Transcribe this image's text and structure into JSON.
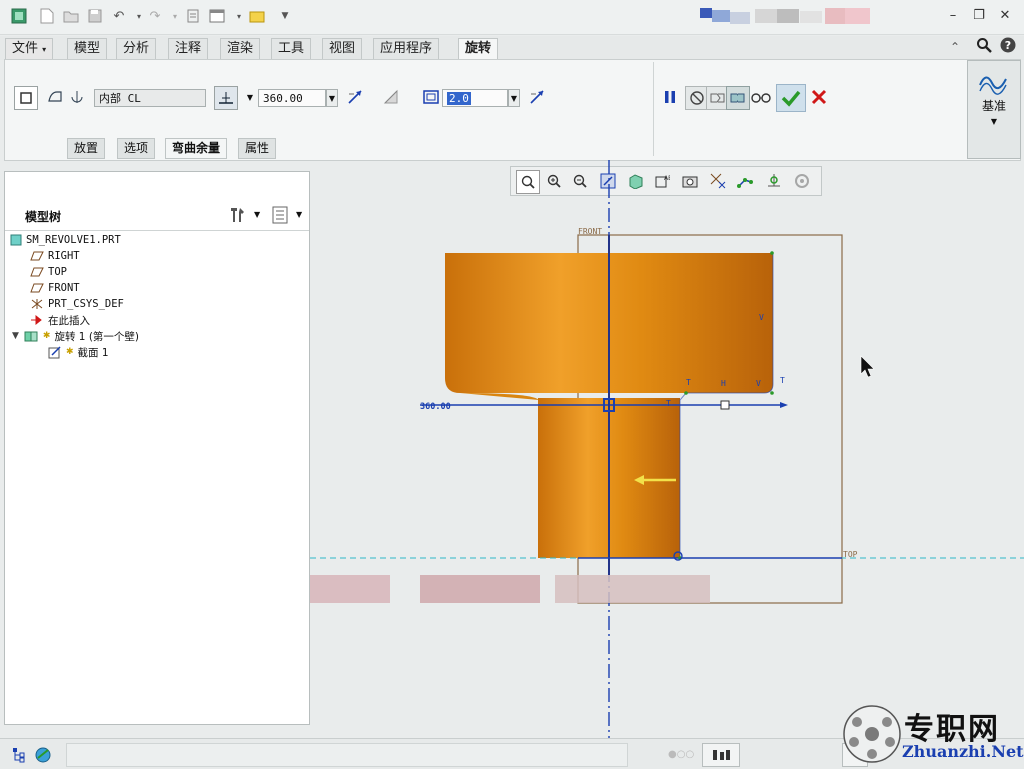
{
  "title_bar": {
    "window_controls": [
      "minimize-icon",
      "restore-icon",
      "close-icon"
    ]
  },
  "tabs": [
    {
      "label": "文件"
    },
    {
      "label": "模型"
    },
    {
      "label": "分析"
    },
    {
      "label": "注释"
    },
    {
      "label": "渲染"
    },
    {
      "label": "工具"
    },
    {
      "label": "视图"
    },
    {
      "label": "应用程序"
    },
    {
      "label": "旋转"
    }
  ],
  "dashboard": {
    "axis_value": "内部 CL",
    "angle_value": "360.00",
    "thickness_value": "2.0",
    "subtabs": [
      "放置",
      "选项",
      "弯曲余量",
      "属性"
    ],
    "datum_label": "基准"
  },
  "model_tree": {
    "title": "模型树",
    "items": [
      {
        "label": "SM_REVOLVE1.PRT",
        "icon": "part-icon"
      },
      {
        "label": "RIGHT",
        "icon": "datum-plane-icon"
      },
      {
        "label": "TOP",
        "icon": "datum-plane-icon"
      },
      {
        "label": "FRONT",
        "icon": "datum-plane-icon"
      },
      {
        "label": "PRT_CSYS_DEF",
        "icon": "csys-icon"
      },
      {
        "label": "在此插入",
        "icon": "insert-arrow-icon"
      },
      {
        "label": "旋转 1 (第一个壁)",
        "icon": "revolve-feature-icon"
      },
      {
        "label": "截面 1",
        "icon": "sketch-icon"
      }
    ]
  },
  "canvas": {
    "labels": {
      "front": "FRONT",
      "top": "TOP",
      "angle": "360.00",
      "t1": "T",
      "h": "H",
      "v1": "V",
      "t2": "T",
      "v2": "V",
      "t3": "T"
    }
  },
  "watermark": {
    "cn": "专职网",
    "url": "Zhuanzhi.Net"
  },
  "colors": {
    "accent_blue": "#1a3fb0",
    "model_orange": "#e08a12",
    "confirm_green": "#2a9a2a",
    "cancel_red": "#d01818"
  }
}
